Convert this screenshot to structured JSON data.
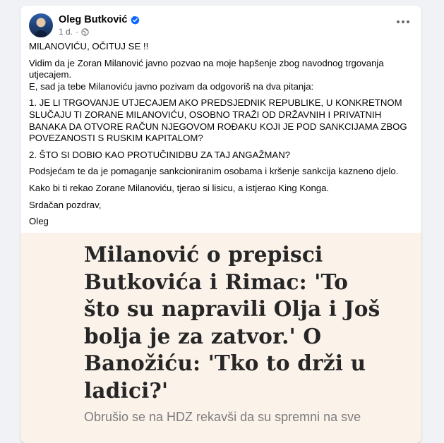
{
  "post": {
    "author": "Oleg Butković",
    "time": "1 d.",
    "separator": "·",
    "paragraphs": [
      "MILANOVIĆU, OČITUJ SE !!",
      "Vidim da je Zoran Milanović javno pozvao na moje hapšenje zbog navodnog trgovanja utjecajem.",
      "E, sad ja tebe Milanoviću javno pozivam da odgovoriš na dva pitanja:",
      "1. JE LI TRGOVANJE UTJECAJEM AKO PREDSJEDNIK REPUBLIKE, U KONKRETNOM SLUČAJU TI ZORANE MILANOVIĆU, OSOBNO TRAŽI OD DRŽAVNIH I PRIVATNIH BANAKA DA OTVORE RAČUN NJEGOVOM ROĐAKU KOJI JE POD SANKCIJAMA ZBOG POVEZANOSTI S RUSKIM KAPITALOM?",
      "2. ŠTO SI DOBIO KAO PROTUČINIDBU ZA TAJ ANGAŽMAN?",
      "Podsjećam te da je pomaganje sankcioniranim osobama i kršenje sankcija kazneno djelo.",
      "Kako bi ti rekao Zorane Milanoviću, tjerao si lisicu, a istjerao King Konga.",
      "Srdačan pozdrav,",
      "Oleg"
    ]
  },
  "article": {
    "title": "Milanović o prepisci Butkovića i Rimac: 'To što su napravili Olja i Još bolja je za zatvor.' O Banožiću: 'Tko to drži u ladici?'",
    "subtitle": "Obrušio se na HDZ rekavši da su spremni na sve"
  },
  "icons": {
    "verified": "verified-badge-icon",
    "privacy": "globe-icon",
    "more": "more-options-icon"
  },
  "colors": {
    "verified": "#0866ff",
    "article_bg": "#fbf2ea",
    "page_bg": "#f0f2f5"
  }
}
